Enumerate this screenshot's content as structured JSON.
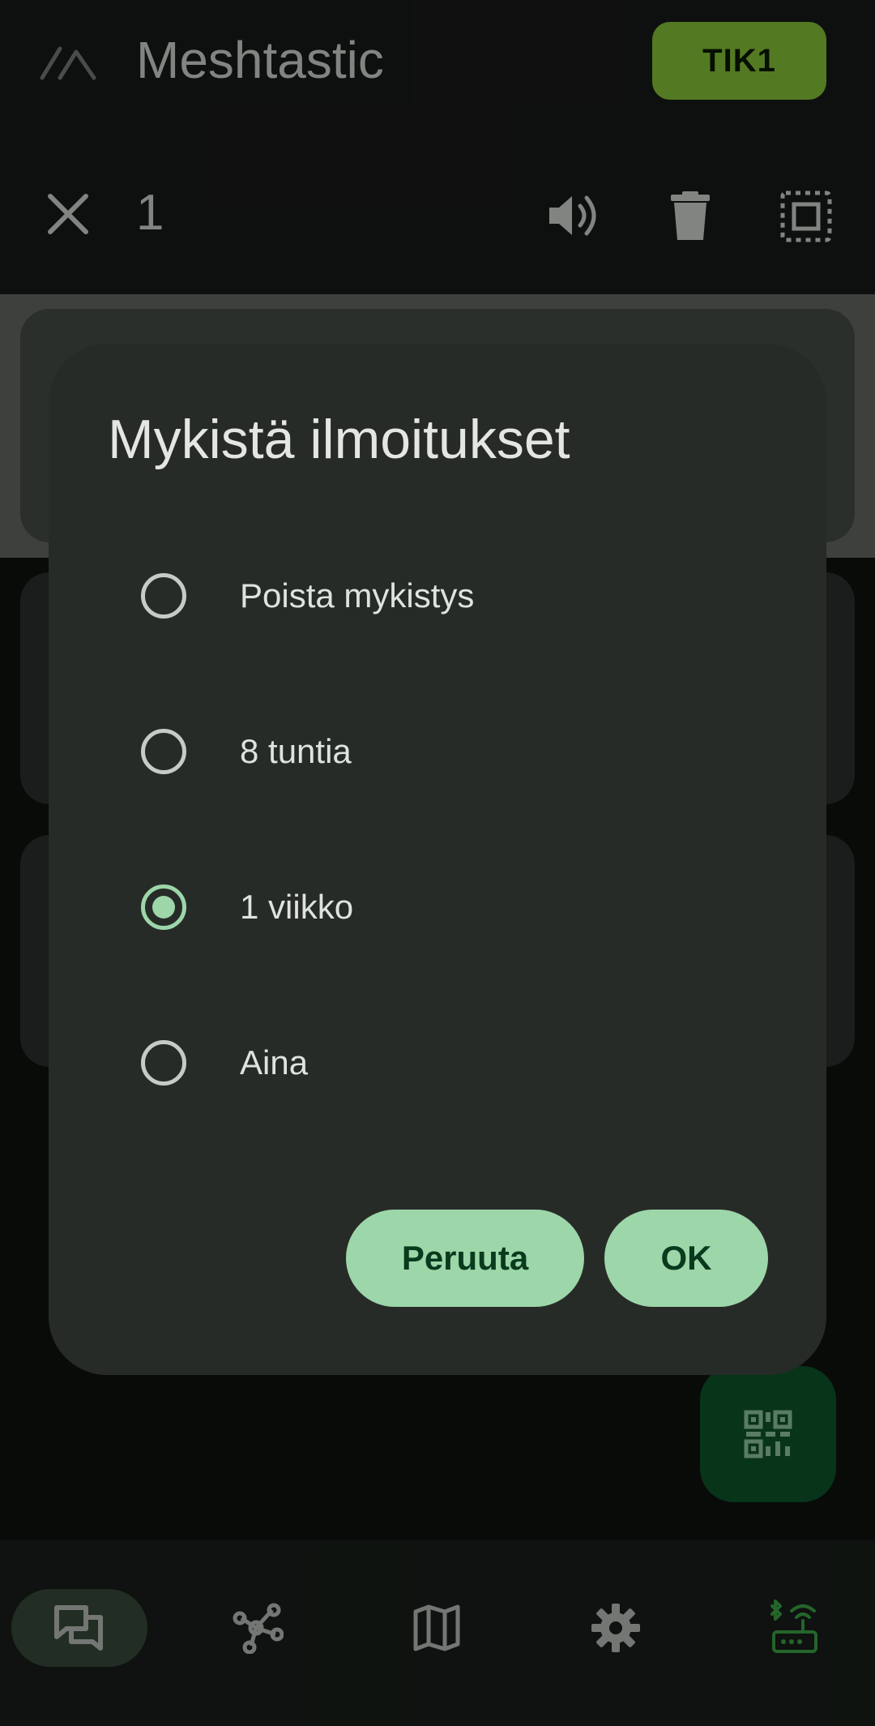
{
  "app": {
    "title": "Meshtastic",
    "node_chip": "TIK1"
  },
  "selection_bar": {
    "count": "1"
  },
  "dialog": {
    "title": "Mykistä ilmoitukset",
    "options": [
      {
        "label": "Poista mykistys",
        "selected": false
      },
      {
        "label": "8 tuntia",
        "selected": false
      },
      {
        "label": "1 viikko",
        "selected": true
      },
      {
        "label": "Aina",
        "selected": false
      }
    ],
    "cancel_label": "Peruuta",
    "ok_label": "OK"
  },
  "icons": {
    "logo": "meshtastic-logo-icon",
    "close": "close-icon",
    "mute": "volume-icon",
    "delete": "trash-icon",
    "select_all": "select-all-icon",
    "fab": "qr-code-icon",
    "nav": [
      "chat-icon",
      "nodes-icon",
      "map-icon",
      "settings-icon",
      "bluetooth-router-icon"
    ]
  },
  "colors": {
    "accent": "#9cd6a9",
    "chip": "#8fd13b",
    "fab": "#0f5a2d",
    "connected": "#3fae49"
  }
}
